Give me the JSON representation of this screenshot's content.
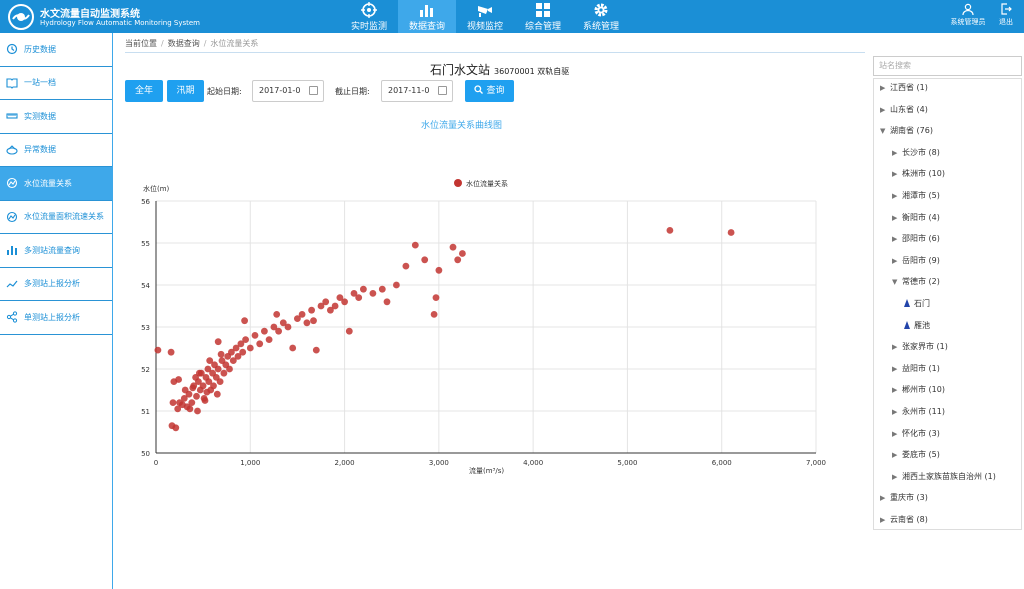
{
  "header": {
    "title": "水文流量自动监测系统",
    "subtitle": "Hydrology Flow Automatic Monitoring System",
    "nav": [
      {
        "label": "实时监测",
        "icon": "target-icon"
      },
      {
        "label": "数据查询",
        "icon": "bar-chart-icon"
      },
      {
        "label": "视频监控",
        "icon": "camera-icon"
      },
      {
        "label": "综合管理",
        "icon": "grid-icon"
      },
      {
        "label": "系统管理",
        "icon": "gear-icon"
      }
    ],
    "user_label": "系统管理员",
    "logout_label": "退出",
    "colors": {
      "brand": "#1b8fd6",
      "active_nav": "#3ea8ea"
    }
  },
  "sidebar": {
    "items": [
      {
        "label": "历史数据",
        "icon": "history-icon"
      },
      {
        "label": "一站一档",
        "icon": "book-icon"
      },
      {
        "label": "实测数据",
        "icon": "measure-icon"
      },
      {
        "label": "异常数据",
        "icon": "warning-icon"
      },
      {
        "label": "水位流量关系",
        "icon": "relation-icon"
      },
      {
        "label": "水位流量面积流速关系",
        "icon": "relation-icon"
      },
      {
        "label": "多测站流量查询",
        "icon": "bar-chart-icon"
      },
      {
        "label": "多测站上报分析",
        "icon": "line-chart-icon"
      },
      {
        "label": "单测站上报分析",
        "icon": "share-icon"
      }
    ]
  },
  "breadcrumb": {
    "label": "当前位置",
    "parent": "数据查询",
    "current": "水位流量关系"
  },
  "station": {
    "name": "石门水文站",
    "code": "36070001 双轨自驱"
  },
  "toolbar": {
    "btn_all_year": "全年",
    "btn_flood": "汛期",
    "start_label": "起始日期:",
    "start_value": "2017-01-0",
    "end_label": "截止日期:",
    "end_value": "2017-11-0",
    "query_label": "查询"
  },
  "chart_title": "水位流量关系曲线图",
  "chart_data": {
    "type": "scatter",
    "ylabel": "水位(m)",
    "xlabel": "流量(m³/s)",
    "legend": "水位流量关系",
    "legend_position": "top-center",
    "color": "#c23531",
    "xlim": [
      0,
      7000
    ],
    "ylim": [
      50,
      56
    ],
    "x_ticks": [
      "0",
      "1,000",
      "2,000",
      "3,000",
      "4,000",
      "5,000",
      "6,000",
      "7,000"
    ],
    "y_ticks": [
      "50",
      "51",
      "52",
      "53",
      "54",
      "55",
      "56"
    ],
    "grid": true,
    "points": [
      [
        20,
        52.45
      ],
      [
        160,
        52.4
      ],
      [
        170,
        50.65
      ],
      [
        210,
        50.6
      ],
      [
        190,
        51.7
      ],
      [
        240,
        51.75
      ],
      [
        250,
        51.2
      ],
      [
        180,
        51.2
      ],
      [
        300,
        51.3
      ],
      [
        330,
        51.1
      ],
      [
        350,
        51.4
      ],
      [
        380,
        51.2
      ],
      [
        400,
        51.6
      ],
      [
        420,
        51.8
      ],
      [
        430,
        51.35
      ],
      [
        450,
        51.7
      ],
      [
        470,
        51.5
      ],
      [
        480,
        51.9
      ],
      [
        500,
        51.6
      ],
      [
        510,
        51.3
      ],
      [
        530,
        51.8
      ],
      [
        540,
        51.45
      ],
      [
        550,
        52.0
      ],
      [
        560,
        51.7
      ],
      [
        580,
        51.5
      ],
      [
        600,
        51.9
      ],
      [
        610,
        51.6
      ],
      [
        620,
        52.1
      ],
      [
        640,
        51.8
      ],
      [
        650,
        51.4
      ],
      [
        660,
        52.0
      ],
      [
        680,
        51.7
      ],
      [
        700,
        52.2
      ],
      [
        720,
        51.9
      ],
      [
        740,
        52.1
      ],
      [
        760,
        52.3
      ],
      [
        780,
        52.0
      ],
      [
        800,
        52.4
      ],
      [
        820,
        52.2
      ],
      [
        850,
        52.5
      ],
      [
        870,
        52.3
      ],
      [
        900,
        52.6
      ],
      [
        920,
        52.4
      ],
      [
        950,
        52.7
      ],
      [
        1000,
        52.5
      ],
      [
        1050,
        52.8
      ],
      [
        1100,
        52.6
      ],
      [
        1150,
        52.9
      ],
      [
        1200,
        52.7
      ],
      [
        1250,
        53.0
      ],
      [
        1300,
        52.9
      ],
      [
        1350,
        53.1
      ],
      [
        1400,
        53.0
      ],
      [
        1450,
        52.5
      ],
      [
        1500,
        53.2
      ],
      [
        1550,
        53.3
      ],
      [
        1600,
        53.1
      ],
      [
        1650,
        53.4
      ],
      [
        1700,
        52.45
      ],
      [
        1750,
        53.5
      ],
      [
        1800,
        53.6
      ],
      [
        1850,
        53.4
      ],
      [
        1900,
        53.5
      ],
      [
        1950,
        53.7
      ],
      [
        2000,
        53.6
      ],
      [
        2050,
        52.9
      ],
      [
        2100,
        53.8
      ],
      [
        2150,
        53.7
      ],
      [
        2200,
        53.9
      ],
      [
        2300,
        53.8
      ],
      [
        2400,
        53.9
      ],
      [
        2450,
        53.6
      ],
      [
        2550,
        54.0
      ],
      [
        2650,
        54.45
      ],
      [
        2750,
        54.95
      ],
      [
        2850,
        54.6
      ],
      [
        2950,
        53.3
      ],
      [
        2970,
        53.7
      ],
      [
        3000,
        54.35
      ],
      [
        3150,
        54.9
      ],
      [
        3200,
        54.6
      ],
      [
        3250,
        54.75
      ],
      [
        940,
        53.15
      ],
      [
        1280,
        53.3
      ],
      [
        1670,
        53.15
      ],
      [
        660,
        52.65
      ],
      [
        520,
        51.25
      ],
      [
        440,
        51.0
      ],
      [
        360,
        51.05
      ],
      [
        280,
        51.15
      ],
      [
        230,
        51.05
      ],
      [
        310,
        51.5
      ],
      [
        390,
        51.55
      ],
      [
        460,
        51.9
      ],
      [
        570,
        52.2
      ],
      [
        690,
        52.35
      ],
      [
        5450,
        55.3
      ],
      [
        6100,
        55.25
      ]
    ]
  },
  "tree": {
    "search_placeholder": "站名搜索",
    "nodes": [
      {
        "label": "江西省 (1)",
        "level": 0,
        "expanded": false
      },
      {
        "label": "山东省 (4)",
        "level": 0,
        "expanded": false
      },
      {
        "label": "湖南省 (76)",
        "level": 0,
        "expanded": true
      },
      {
        "label": "长沙市 (8)",
        "level": 1,
        "expanded": false
      },
      {
        "label": "株洲市 (10)",
        "level": 1,
        "expanded": false
      },
      {
        "label": "湘潭市 (5)",
        "level": 1,
        "expanded": false
      },
      {
        "label": "衡阳市 (4)",
        "level": 1,
        "expanded": false
      },
      {
        "label": "邵阳市 (6)",
        "level": 1,
        "expanded": false
      },
      {
        "label": "岳阳市 (9)",
        "level": 1,
        "expanded": false
      },
      {
        "label": "常德市 (2)",
        "level": 1,
        "expanded": true
      },
      {
        "label": "石门",
        "level": 2,
        "station": true
      },
      {
        "label": "雁池",
        "level": 2,
        "station": true
      },
      {
        "label": "张家界市 (1)",
        "level": 1,
        "expanded": false
      },
      {
        "label": "益阳市 (1)",
        "level": 1,
        "expanded": false
      },
      {
        "label": "郴州市 (10)",
        "level": 1,
        "expanded": false
      },
      {
        "label": "永州市 (11)",
        "level": 1,
        "expanded": false
      },
      {
        "label": "怀化市 (3)",
        "level": 1,
        "expanded": false
      },
      {
        "label": "娄底市 (5)",
        "level": 1,
        "expanded": false
      },
      {
        "label": "湘西土家族苗族自治州 (1)",
        "level": 1,
        "expanded": false
      },
      {
        "label": "重庆市 (3)",
        "level": 0,
        "expanded": false
      },
      {
        "label": "云南省 (8)",
        "level": 0,
        "expanded": false
      }
    ]
  }
}
